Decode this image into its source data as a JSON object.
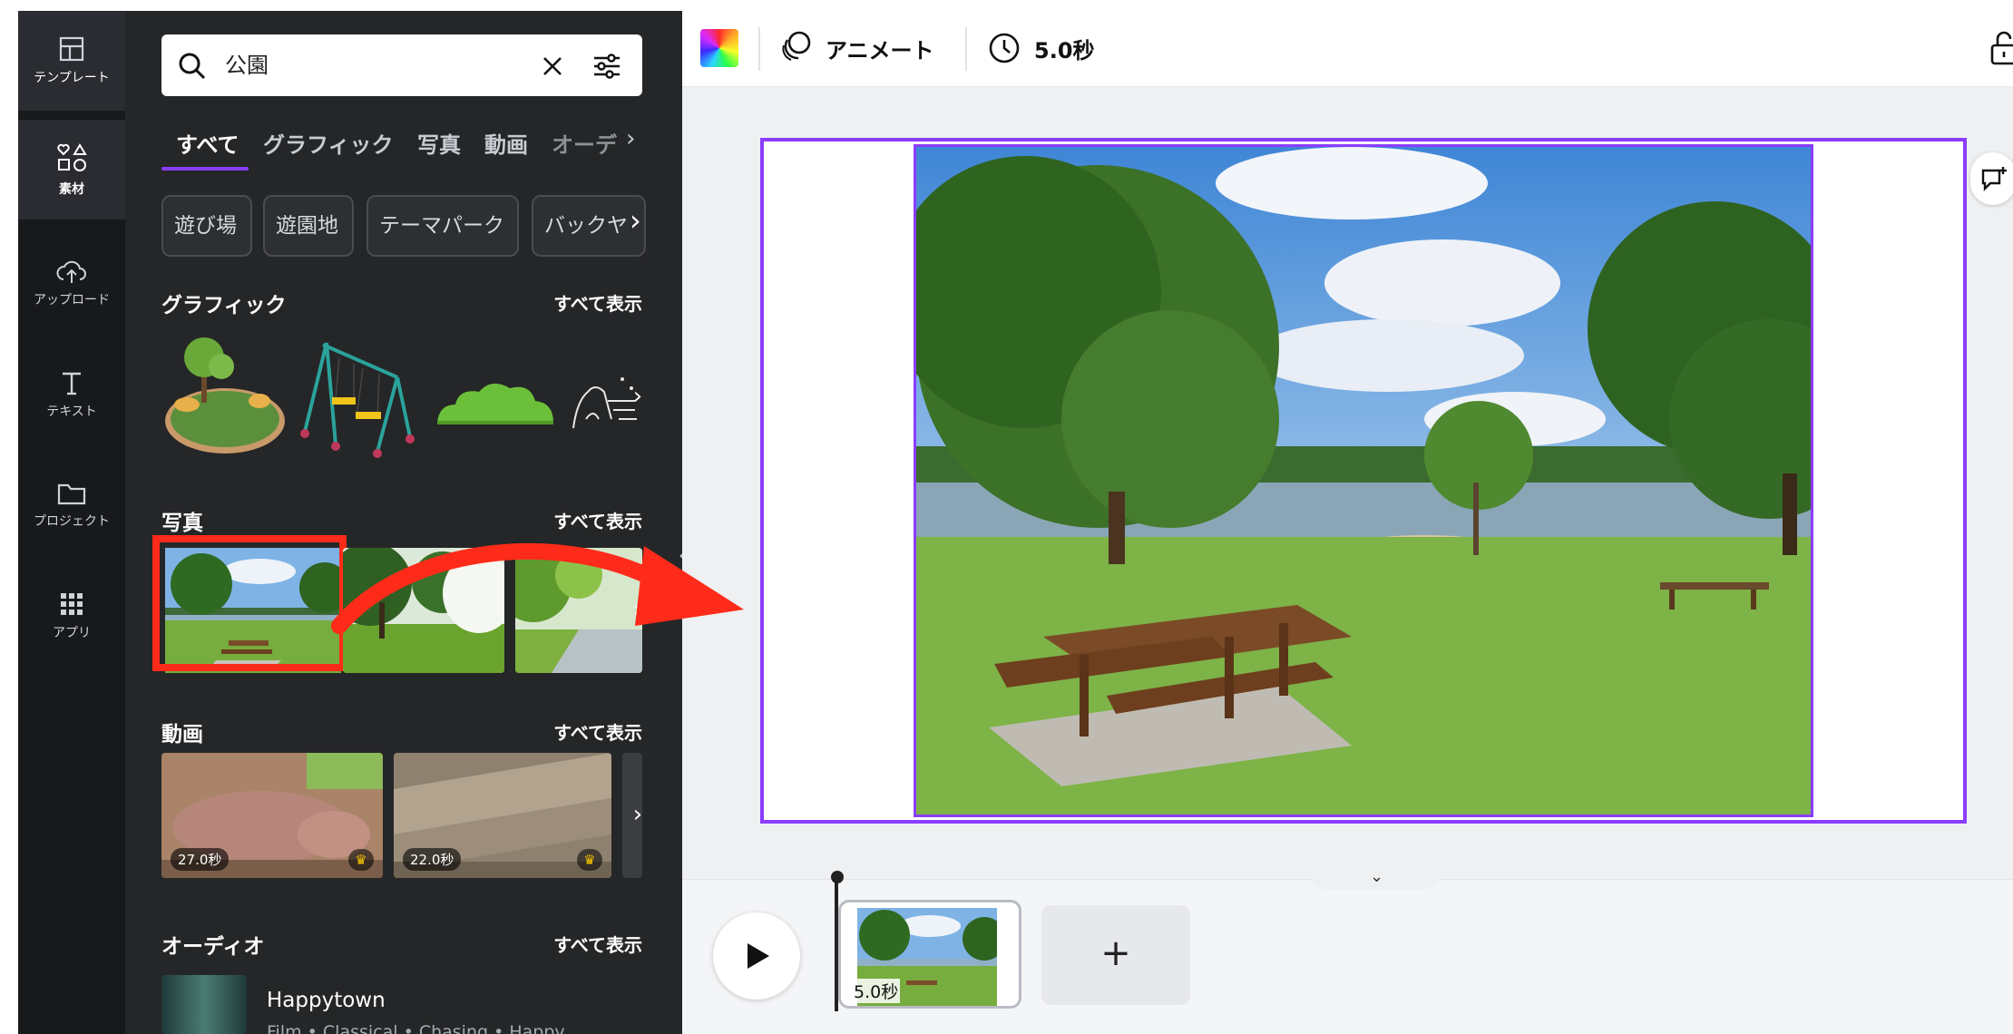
{
  "rail": {
    "items": [
      {
        "label": "テンプレート",
        "icon": "template-icon"
      },
      {
        "label": "素材",
        "icon": "elements-icon"
      },
      {
        "label": "アップロード",
        "icon": "upload-icon"
      },
      {
        "label": "テキスト",
        "icon": "text-icon"
      },
      {
        "label": "プロジェクト",
        "icon": "folder-icon"
      },
      {
        "label": "アプリ",
        "icon": "apps-icon"
      }
    ]
  },
  "search": {
    "value": "公園"
  },
  "tabs": [
    "すべて",
    "グラフィック",
    "写真",
    "動画",
    "オーデ"
  ],
  "chips": [
    "遊び場",
    "遊園地",
    "テーマパーク",
    "バックヤ"
  ],
  "sections": {
    "graphics": {
      "title": "グラフィック",
      "see_all": "すべて表示"
    },
    "photos": {
      "title": "写真",
      "see_all": "すべて表示"
    },
    "videos": {
      "title": "動画",
      "see_all": "すべて表示",
      "items": [
        {
          "duration": "27.0秒"
        },
        {
          "duration": "22.0秒"
        }
      ]
    },
    "audio": {
      "title": "オーディオ",
      "see_all": "すべて表示",
      "item": {
        "title": "Happytown",
        "tags": "Film • Classical • Chasing • Happy"
      }
    }
  },
  "topbar": {
    "animate": "アニメート",
    "duration": "5.0秒"
  },
  "timeline": {
    "clip_duration": "5.0秒",
    "add": "+"
  },
  "colors": {
    "accent": "#8b3dff",
    "highlight": "#ff2b1a",
    "rail_bg": "#18191b",
    "panel_bg": "#252627"
  }
}
